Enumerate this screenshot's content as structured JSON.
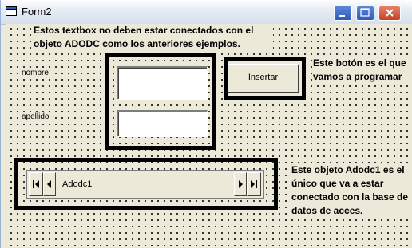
{
  "window": {
    "title": "Form2"
  },
  "form": {
    "note_textboxes": "Estos textbox no deben estar conectados con el objeto ADODC como los anteriores ejemplos.",
    "note_button": "Este botón es el que vamos a programar",
    "note_adodc": "Este objeto Adodc1 es el único que va a estar conectado con la base de datos de acces.",
    "label_nombre": "nombre",
    "label_apellido": "apellido",
    "textbox_nombre_value": "",
    "textbox_apellido_value": "",
    "button_insertar": "Insertar",
    "adodc_caption": "Adodc1"
  },
  "icons": {
    "app": "form-window-icon",
    "minimize": "minimize-icon",
    "maximize": "maximize-icon",
    "close": "close-icon",
    "first": "move-first-icon",
    "prev": "move-previous-icon",
    "next": "move-next-icon",
    "last": "move-last-icon"
  },
  "colors": {
    "form_background": "#ece9d8",
    "annotation_frame": "#000000",
    "titlebar_button": "#2d5bbe",
    "close_button": "#c6401f"
  }
}
